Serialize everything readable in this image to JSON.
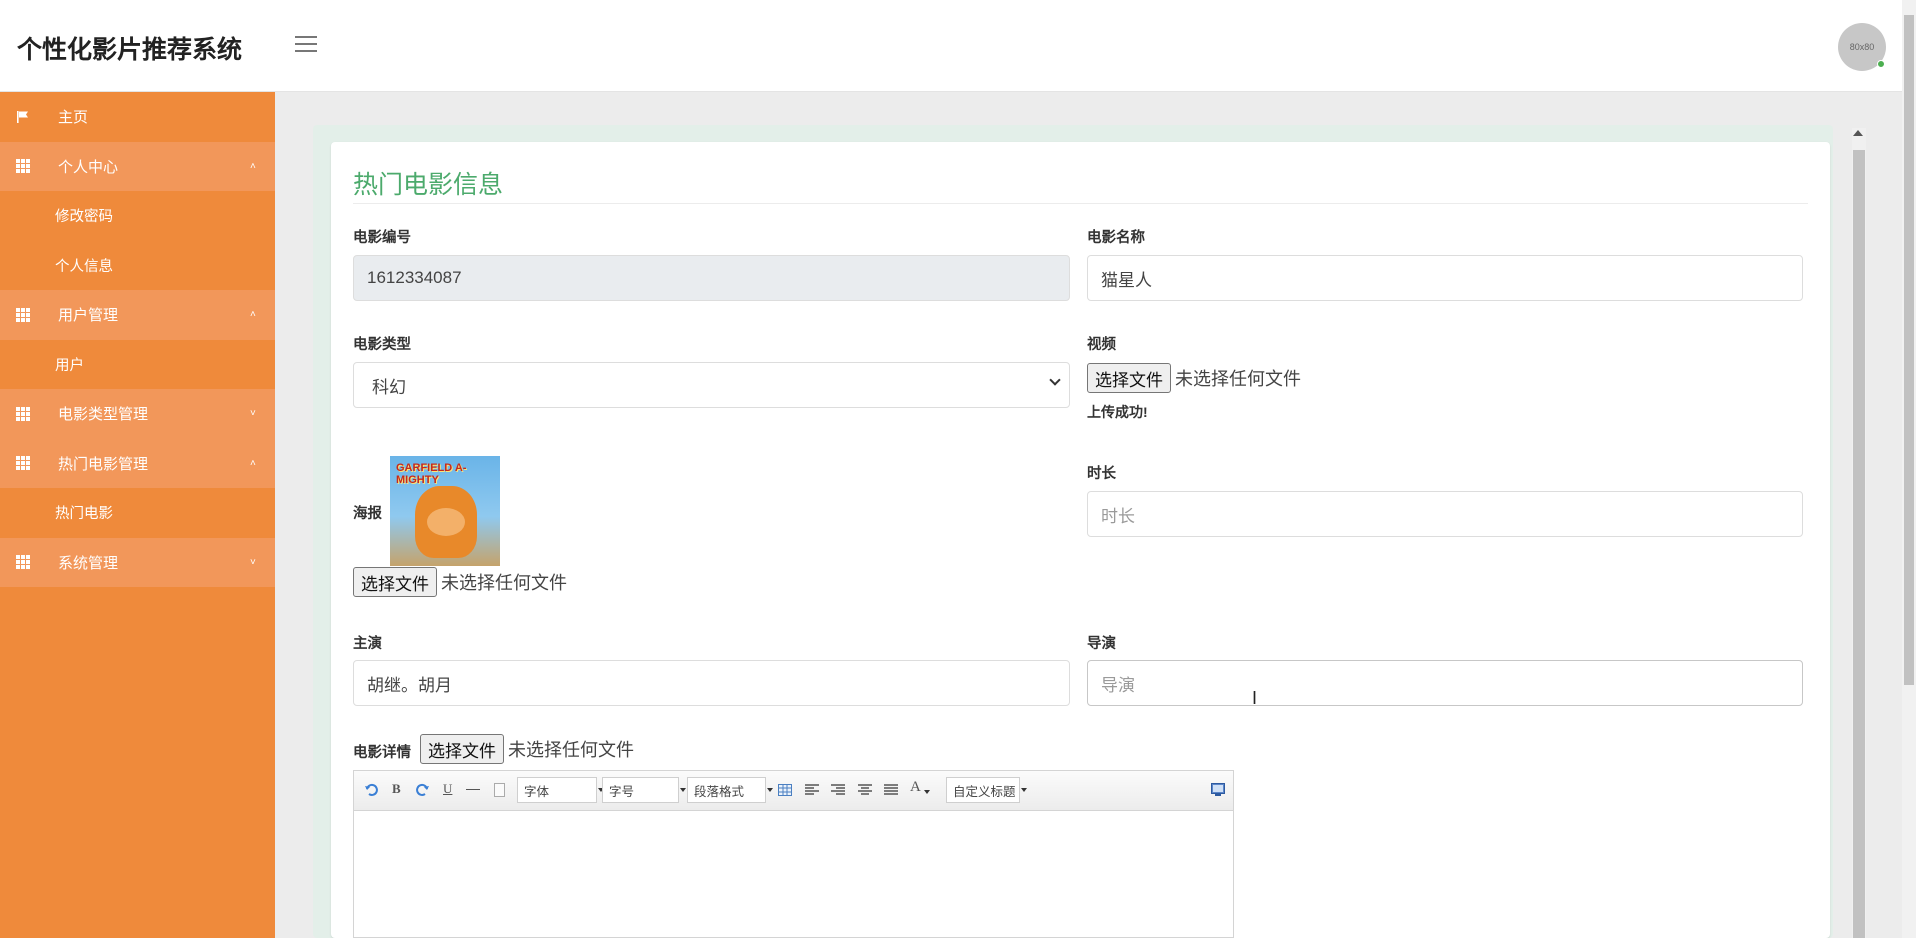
{
  "app": {
    "title": "个性化影片推荐系统",
    "avatar_text": "80x80"
  },
  "sidebar": {
    "items": [
      {
        "label": "主页",
        "type": "top",
        "icon": "flag-icon"
      },
      {
        "label": "个人中心",
        "type": "group",
        "icon": "grid-icon",
        "caret": "˄"
      },
      {
        "label": "修改密码",
        "type": "sub"
      },
      {
        "label": "个人信息",
        "type": "sub"
      },
      {
        "label": "用户管理",
        "type": "group",
        "icon": "grid-icon",
        "caret": "˄"
      },
      {
        "label": "用户",
        "type": "sub"
      },
      {
        "label": "电影类型管理",
        "type": "group",
        "icon": "grid-icon",
        "caret": "˅"
      },
      {
        "label": "热门电影管理",
        "type": "group",
        "icon": "grid-icon",
        "caret": "˄"
      },
      {
        "label": "热门电影",
        "type": "sub"
      },
      {
        "label": "系统管理",
        "type": "group",
        "icon": "grid-icon",
        "caret": "˅"
      }
    ]
  },
  "form": {
    "title": "热门电影信息",
    "movie_id": {
      "label": "电影编号",
      "value": "1612334087"
    },
    "movie_name": {
      "label": "电影名称",
      "value": "猫星人"
    },
    "movie_type": {
      "label": "电影类型",
      "value": "科幻"
    },
    "video": {
      "label": "视频",
      "button": "选择文件",
      "status": "未选择任何文件",
      "upload_message": "上传成功!"
    },
    "poster": {
      "label": "海报",
      "button": "选择文件",
      "status": "未选择任何文件",
      "image_text": "GARFIELD A-MIGHTY"
    },
    "duration": {
      "label": "时长",
      "placeholder": "时长"
    },
    "starring": {
      "label": "主演",
      "value": "胡继。胡月"
    },
    "director": {
      "label": "导演",
      "placeholder": "导演"
    },
    "details": {
      "label": "电影详情",
      "button": "选择文件",
      "status": "未选择任何文件"
    }
  },
  "editor": {
    "font_label": "字体",
    "size_label": "字号",
    "paragraph_label": "段落格式",
    "custom_title_label": "自定义标题",
    "bold": "B",
    "underline": "U",
    "font_color": "A"
  }
}
